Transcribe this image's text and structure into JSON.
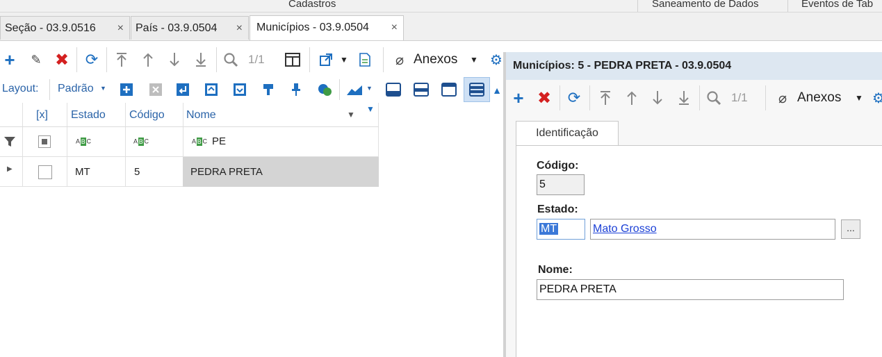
{
  "ribbon": {
    "center_label": "Cadastros",
    "right_tabs": [
      "Saneamento de Dados",
      "Eventos de Tab"
    ]
  },
  "tabs": [
    {
      "label": "Seção - 03.9.0516",
      "close": "×"
    },
    {
      "label": "País - 03.9.0504",
      "close": "×"
    },
    {
      "label": "Municípios - 03.9.0504",
      "close": "×"
    }
  ],
  "toolbar": {
    "page_indicator": "1/1",
    "anexos_label": "Anexos",
    "layout_label": "Layout:",
    "layout_value": "Padrão"
  },
  "grid": {
    "columns": [
      "[x]",
      "Estado",
      "Código",
      "Nome"
    ],
    "filter_row": {
      "nome_filter": "PE"
    },
    "rows": [
      {
        "estado": "MT",
        "codigo": "5",
        "nome": "PEDRA PRETA"
      }
    ]
  },
  "dialog": {
    "title": "Municípios: 5 - PEDRA PRETA - 03.9.0504",
    "page_indicator": "1/1",
    "anexos_label": "Anexos",
    "tab_label": "Identificação",
    "fields": {
      "codigo_label": "Código:",
      "codigo_value": "5",
      "estado_label": "Estado:",
      "estado_code": "MT",
      "estado_name": "Mato Grosso",
      "lookup_button": "...",
      "nome_label": "Nome:",
      "nome_value": "PEDRA PRETA"
    }
  },
  "colors": {
    "accent_blue": "#1e6fc0",
    "delete_red": "#d42020",
    "header_text": "#2a63a8",
    "dialog_title_bg": "#dde7f1",
    "selection": "#3b78d8"
  }
}
